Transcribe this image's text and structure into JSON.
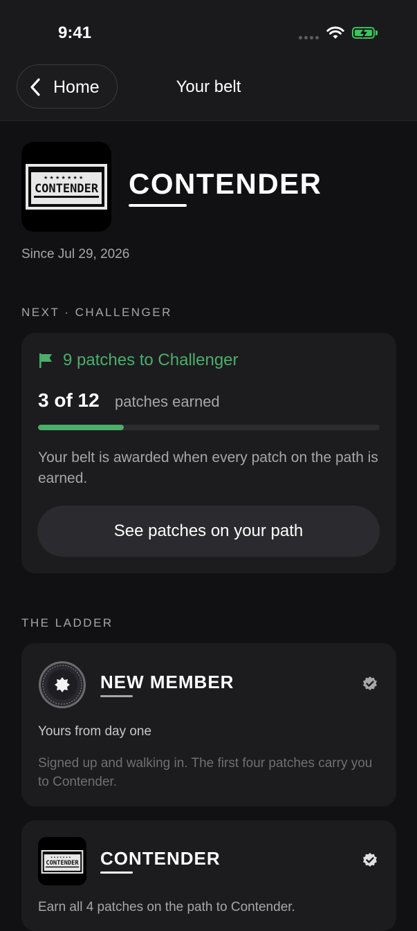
{
  "status": {
    "time": "9:41"
  },
  "nav": {
    "back_label": "Home",
    "title": "Your belt"
  },
  "hero": {
    "badge_text": "CONTENDER",
    "title": "CONTENDER",
    "since": "Since Jul 29, 2026"
  },
  "next": {
    "section_label": "NEXT · CHALLENGER",
    "goal": "9 patches to Challenger",
    "count": "3 of 12",
    "count_suffix": "patches earned",
    "progress": 0.25,
    "description": "Your belt is awarded when every patch on the path is earned.",
    "button_label": "See patches on your path"
  },
  "ladder": {
    "section_label": "THE LADDER",
    "tiers": [
      {
        "name": "NEW MEMBER",
        "subtitle": "Yours from day one",
        "description": "Signed up and walking in. The first four patches carry you to Contender.",
        "icon": "new-member-medallion-icon",
        "completed": true
      },
      {
        "name": "CONTENDER",
        "badge_text": "CONTENDER",
        "description": "Earn all 4 patches on the path to Contender.",
        "icon": "contender-badge-icon",
        "completed": true
      }
    ]
  },
  "colors": {
    "background": "#111113",
    "card": "#1c1c1f",
    "accent_green": "#4cae6a",
    "muted_text": "#a7a7ab"
  }
}
